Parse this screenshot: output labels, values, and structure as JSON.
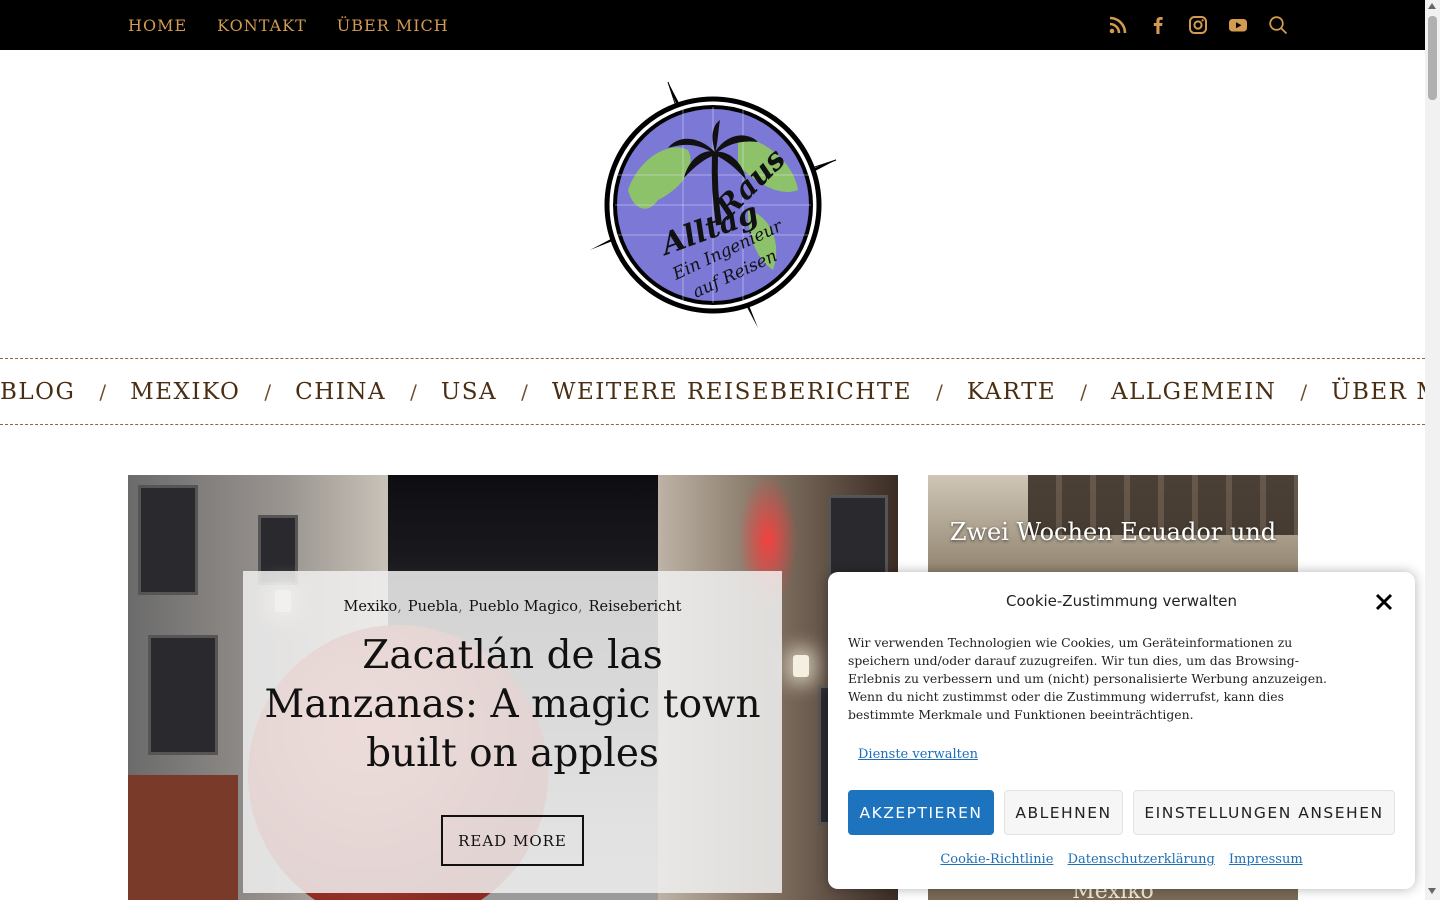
{
  "topnav": {
    "items": [
      {
        "label": "HOME"
      },
      {
        "label": "KONTAKT"
      },
      {
        "label": "ÜBER MICH"
      }
    ],
    "icons": [
      "rss-icon",
      "facebook-icon",
      "instagram-icon",
      "youtube-icon",
      "search-icon"
    ],
    "accent_color": "#d39a52"
  },
  "logo": {
    "line1": "Alltag",
    "line2": "Raus",
    "line3": "Ein Ingenieur",
    "line4": "auf Reisen"
  },
  "mainnav": {
    "separator": "/",
    "items": [
      {
        "label": "BLOG"
      },
      {
        "label": "MEXIKO"
      },
      {
        "label": "CHINA"
      },
      {
        "label": "USA"
      },
      {
        "label": "WEITERE REISEBERICHTE"
      },
      {
        "label": "KARTE"
      },
      {
        "label": "ALLGEMEIN"
      },
      {
        "label": "ÜBER MICH"
      }
    ]
  },
  "hero": {
    "categories": [
      "Mexiko",
      "Puebla",
      "Pueblo Magico",
      "Reisebericht"
    ],
    "title": "Zacatlán de las Manzanas: A magic town built on apples",
    "button": "READ MORE"
  },
  "side": {
    "title": "Zwei Wochen Ecuador und",
    "bottom_text": "Mexiko"
  },
  "cookie": {
    "title": "Cookie-Zustimmung verwalten",
    "text": "Wir verwenden Technologien wie Cookies, um Geräteinformationen zu speichern und/oder darauf zuzugreifen. Wir tun dies, um das Browsing-Erlebnis zu verbessern und um (nicht) personalisierte Werbung anzuzeigen. Wenn du nicht zustimmst oder die Zustimmung widerrufst, kann dies bestimmte Merkmale und Funktionen beeinträchtigen.",
    "manage": "Dienste verwalten",
    "accept": "AKZEPTIEREN",
    "deny": "ABLEHNEN",
    "preferences": "EINSTELLUNGEN ANSEHEN",
    "links": [
      "Cookie-Richtlinie",
      "Datenschutzerklärung",
      "Impressum"
    ],
    "accent_color": "#1e73be"
  }
}
